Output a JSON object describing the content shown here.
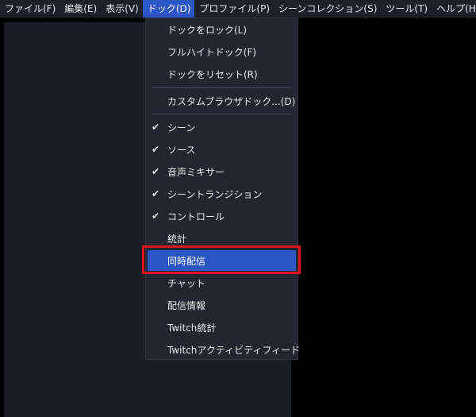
{
  "menubar": {
    "items": [
      {
        "label": "ファイル(F)"
      },
      {
        "label": "編集(E)"
      },
      {
        "label": "表示(V)"
      },
      {
        "label": "ドック(D)"
      },
      {
        "label": "プロファイル(P)"
      },
      {
        "label": "シーンコレクション(S)"
      },
      {
        "label": "ツール(T)"
      },
      {
        "label": "ヘルプ(H)"
      }
    ],
    "active_index": 3
  },
  "dock_menu": {
    "items": [
      {
        "label": "ドックをロック(L)"
      },
      {
        "label": "フルハイトドック(F)"
      },
      {
        "label": "ドックをリセット(R)"
      },
      {
        "label": "カスタムブラウザドック...(D)"
      },
      {
        "label": "シーン",
        "checked": true
      },
      {
        "label": "ソース",
        "checked": true
      },
      {
        "label": "音声ミキサー",
        "checked": true
      },
      {
        "label": "シーントランジション",
        "checked": true
      },
      {
        "label": "コントロール",
        "checked": true
      },
      {
        "label": "統計"
      },
      {
        "label": "同時配信",
        "highlighted": true
      },
      {
        "label": "チャット"
      },
      {
        "label": "配信情報"
      },
      {
        "label": "Twitch統計"
      },
      {
        "label": "Twitchアクティビティフィード"
      }
    ],
    "check_glyph": "✔"
  },
  "colors": {
    "highlight": "#2b56c6",
    "annotation_box": "#e0121b"
  }
}
